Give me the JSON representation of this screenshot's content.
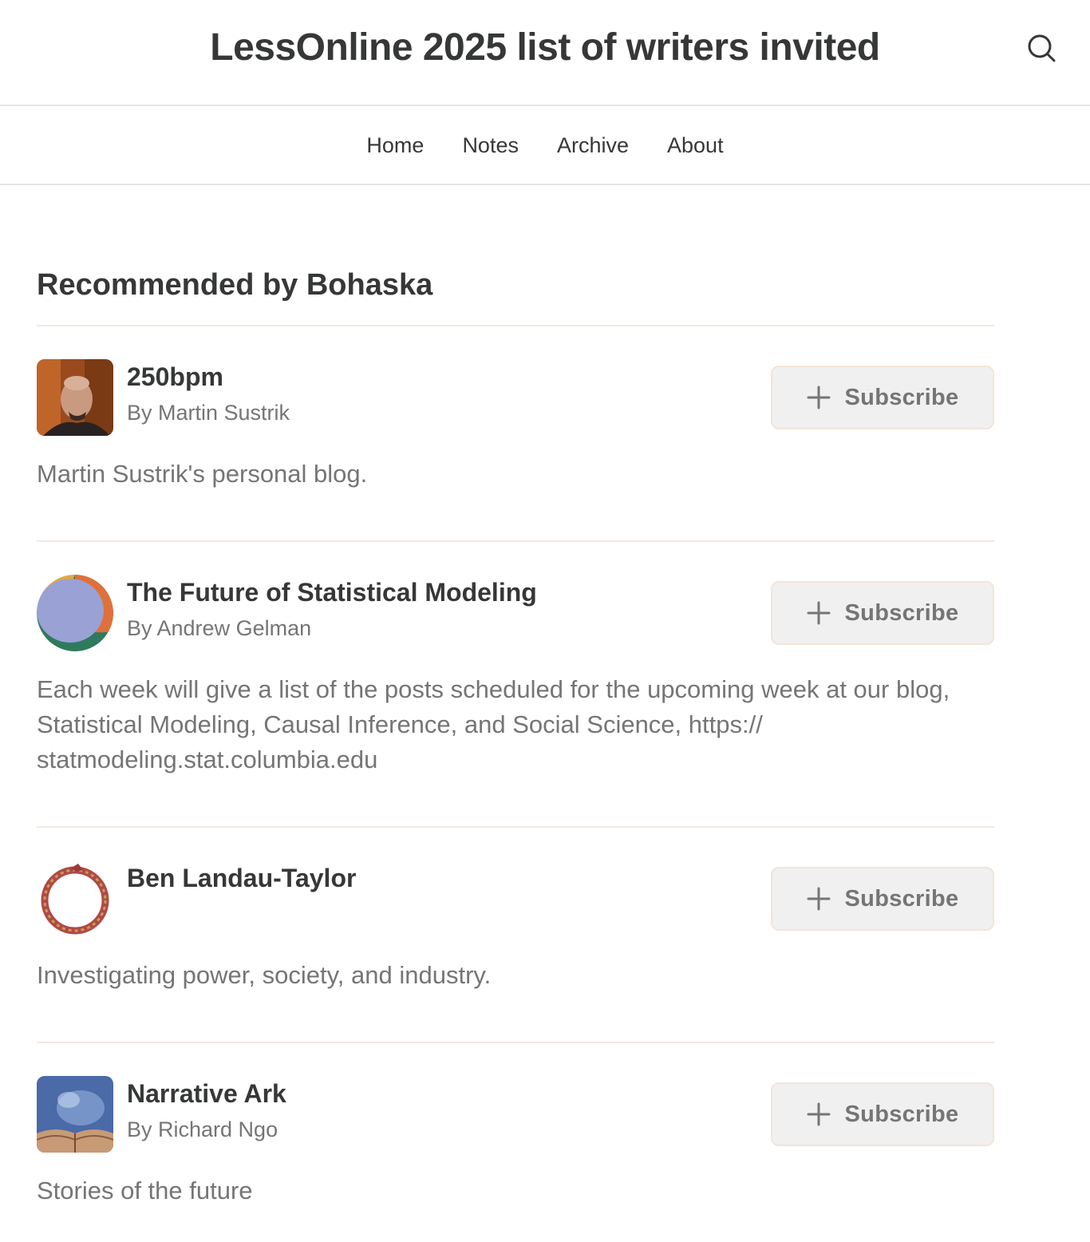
{
  "header": {
    "title": "LessOnline 2025 list of writers invited"
  },
  "nav": {
    "items": [
      {
        "label": "Home"
      },
      {
        "label": "Notes"
      },
      {
        "label": "Archive"
      },
      {
        "label": "About"
      }
    ]
  },
  "recommendations": {
    "title": "Recommended by Bohaska",
    "subscribe_label": "Subscribe",
    "items": [
      {
        "name": "250bpm",
        "author": "By Martin Sustrik",
        "description": "Martin Sustrik's personal blog."
      },
      {
        "name": "The Future of Statistical Modeling",
        "author": "By Andrew Gelman",
        "description": "Each week will give a list of the posts scheduled for the upcoming week at our blog, Statistical Modeling, Causal Inference, and Social Science, https:// statmodeling.stat.columbia.edu"
      },
      {
        "name": "Ben Landau-Taylor",
        "author": "",
        "description": "Investigating power, society, and industry."
      },
      {
        "name": "Narrative Ark",
        "author": "By Richard Ngo",
        "description": "Stories of the future"
      }
    ]
  }
}
